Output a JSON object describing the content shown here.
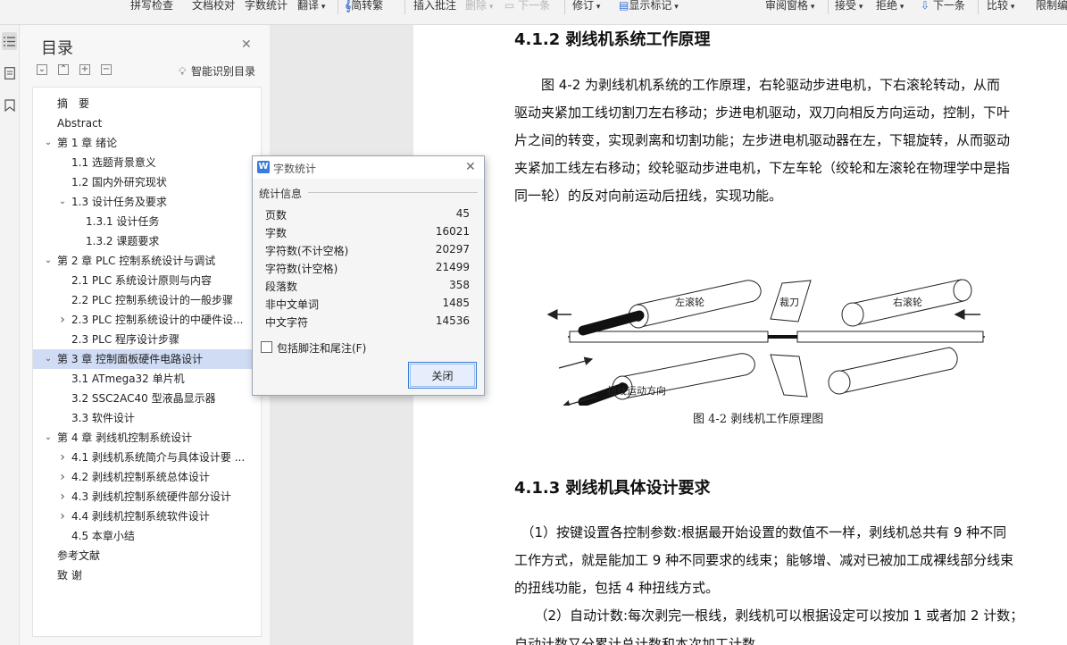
{
  "toolbar": {
    "items": [
      "拼写检查",
      "文档校对",
      "字数统计",
      "翻译",
      "简转繁",
      "插入批注",
      "删除",
      "下一条",
      "修订",
      "显示标记",
      "审阅窗格",
      "接受",
      "拒绝",
      "下一条",
      "比较",
      "限制编"
    ]
  },
  "toc": {
    "title": "目录",
    "smart_label": "智能识别目录",
    "items": [
      {
        "text": "摘　要",
        "level": 1,
        "arrow": ""
      },
      {
        "text": "Abstract",
        "level": 1,
        "arrow": ""
      },
      {
        "text": "第 1 章  绪论",
        "level": 1,
        "arrow": "expanded"
      },
      {
        "text": "1.1 选题背景意义",
        "level": 2,
        "arrow": ""
      },
      {
        "text": "1.2 国内外研究现状",
        "level": 2,
        "arrow": ""
      },
      {
        "text": "1.3 设计任务及要求",
        "level": 2,
        "arrow": "expanded"
      },
      {
        "text": "1.3.1 设计任务",
        "level": 3,
        "arrow": ""
      },
      {
        "text": "1.3.2 课题要求",
        "level": 3,
        "arrow": ""
      },
      {
        "text": "第 2 章  PLC 控制系统设计与调试",
        "level": 1,
        "arrow": "expanded"
      },
      {
        "text": "2.1 PLC 系统设计原则与内容",
        "level": 2,
        "arrow": ""
      },
      {
        "text": "2.2 PLC 控制系统设计的一般步骤",
        "level": 2,
        "arrow": ""
      },
      {
        "text": "2.3 PLC 控制系统设计的中硬件设...",
        "level": 2,
        "arrow": "collapsed"
      },
      {
        "text": "2.3 PLC 程序设计步骤",
        "level": 2,
        "arrow": ""
      },
      {
        "text": "第 3 章  控制面板硬件电路设计",
        "level": 1,
        "arrow": "expanded",
        "selected": true
      },
      {
        "text": "3.1 ATmega32 单片机",
        "level": 2,
        "arrow": ""
      },
      {
        "text": "3.2 SSC2AC40 型液晶显示器",
        "level": 2,
        "arrow": ""
      },
      {
        "text": "3.3 软件设计",
        "level": 2,
        "arrow": ""
      },
      {
        "text": "第 4 章  剥线机控制系统设计",
        "level": 1,
        "arrow": "expanded"
      },
      {
        "text": "4.1  剥线机系统简介与具体设计要 ...",
        "level": 2,
        "arrow": "collapsed"
      },
      {
        "text": "4.2 剥线机控制系统总体设计",
        "level": 2,
        "arrow": "collapsed"
      },
      {
        "text": "4.3 剥线机控制系统硬件部分设计",
        "level": 2,
        "arrow": "collapsed"
      },
      {
        "text": "4.4 剥线机控制系统软件设计",
        "level": 2,
        "arrow": "collapsed"
      },
      {
        "text": "4.5 本章小结",
        "level": 2,
        "arrow": ""
      },
      {
        "text": "参考文献",
        "level": 1,
        "arrow": ""
      },
      {
        "text": "致  谢",
        "level": 1,
        "arrow": ""
      }
    ]
  },
  "dialog": {
    "title": "字数统计",
    "group_label": "统计信息",
    "stats": [
      {
        "label": "页数",
        "value": "45"
      },
      {
        "label": "字数",
        "value": "16021"
      },
      {
        "label": "字符数(不计空格)",
        "value": "20297"
      },
      {
        "label": "字符数(计空格)",
        "value": "21499"
      },
      {
        "label": "段落数",
        "value": "358"
      },
      {
        "label": "非中文单词",
        "value": "1485"
      },
      {
        "label": "中文字符",
        "value": "14536"
      }
    ],
    "checkbox_label": "包括脚注和尾注(F)",
    "close_label": "关闭"
  },
  "document": {
    "heading1": "4.1.2 剥线机系统工作原理",
    "para1_lines": [
      "　　图 4-2 为剥线机机系统的工作原理，右轮驱动步进电机，下右滚轮转动，从而",
      "驱动夹紧加工线切割刀左右移动；步进电机驱动，双刀向相反方向运动，控制，下叶",
      "片之间的转变，实现剥离和切割功能；左步进电机驱动器在左，下辊旋转，从而驱动",
      "夹紧加工线左右移动；绞轮驱动步进电机，下左车轮（绞轮和左滚轮在物理学中是指",
      "同一轮）的反对向前运动后扭线，实现功能。"
    ],
    "figure": {
      "left_roller": "左滚轮",
      "right_roller": "右滚轮",
      "cutter": "裁刀",
      "twist_direction": "扭线运动方向",
      "caption": "图 4-2  剥线机工作原理图"
    },
    "heading2": "4.1.3 剥线机具体设计要求",
    "para2_lines": [
      "　（1）按键设置各控制参数:根据最开始设置的数值不一样，剥线机总共有 9 种不同",
      "工作方式，就是能加工 9 种不同要求的线束；能够增、减对已被加工成裸线部分线束",
      "的扭线功能，包括 4 种扭线方式。",
      "　　（2）自动计数:每次剥完一根线，剥线机可以根据设定可以按加 1 或者加 2 计数；"
    ],
    "para2_cut": "自动计数又分累计总计数和本次加工计数"
  }
}
